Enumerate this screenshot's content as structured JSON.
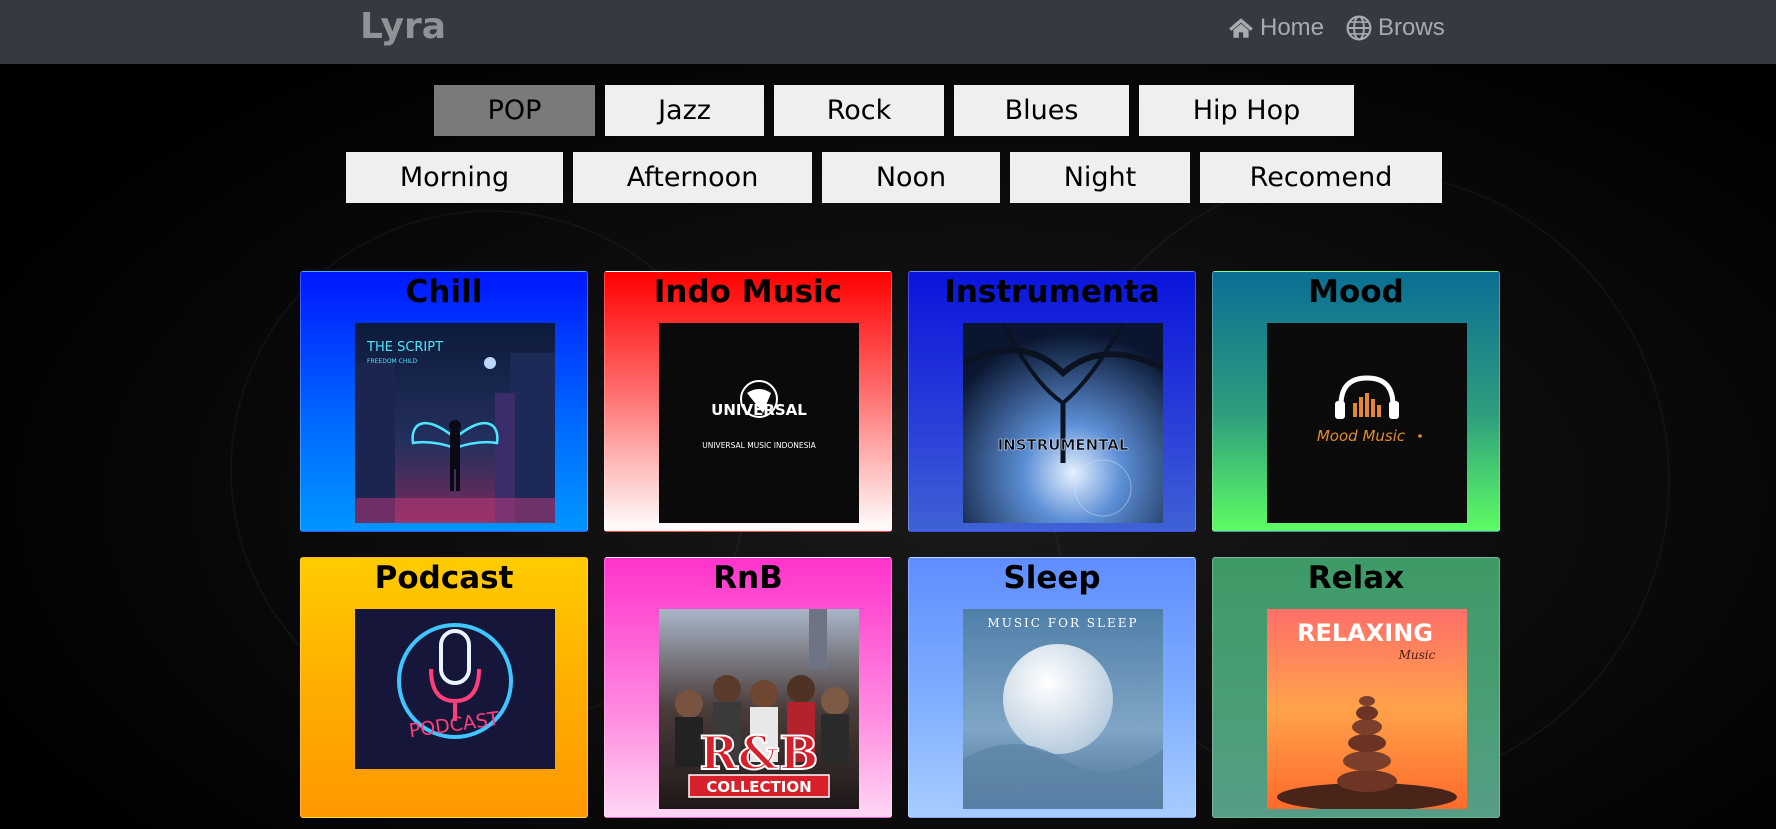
{
  "navbar": {
    "brand": "Lyra",
    "links": [
      {
        "label": "Home",
        "icon": "home-icon"
      },
      {
        "label": "Brows",
        "icon": "globe-icon"
      }
    ]
  },
  "genres_row1": [
    {
      "label": "POP",
      "active": true
    },
    {
      "label": "Jazz",
      "active": false
    },
    {
      "label": "Rock",
      "active": false
    },
    {
      "label": "Blues",
      "active": false
    },
    {
      "label": "Hip Hop",
      "active": false
    }
  ],
  "genres_row2": [
    {
      "label": "Morning"
    },
    {
      "label": "Afternoon"
    },
    {
      "label": "Noon"
    },
    {
      "label": "Night"
    },
    {
      "label": "Recomend"
    }
  ],
  "playlists": [
    {
      "title": "Chill",
      "cover_text": [
        "THE SCRIPT",
        "FREEDOM CHILD"
      ]
    },
    {
      "title": "Indo Music",
      "cover_text": [
        "UNIVERSAL",
        "UNIVERSAL MUSIC INDONESIA"
      ]
    },
    {
      "title": "Instrumenta",
      "cover_text": [
        "INSTRUMENTAL"
      ]
    },
    {
      "title": "Mood",
      "cover_text": [
        "Mood Music"
      ]
    },
    {
      "title": "Podcast",
      "cover_text": [
        "PODCAST"
      ]
    },
    {
      "title": "RnB",
      "cover_text": [
        "R&B",
        "COLLECTION"
      ]
    },
    {
      "title": "Sleep",
      "cover_text": [
        "MUSIC FOR SLEEP"
      ]
    },
    {
      "title": "Relax",
      "cover_text": [
        "RELAXING",
        "Music"
      ]
    }
  ],
  "colors": {
    "navbar": "#343a40",
    "button": "#efefef",
    "button_active": "#7a7a7a"
  }
}
